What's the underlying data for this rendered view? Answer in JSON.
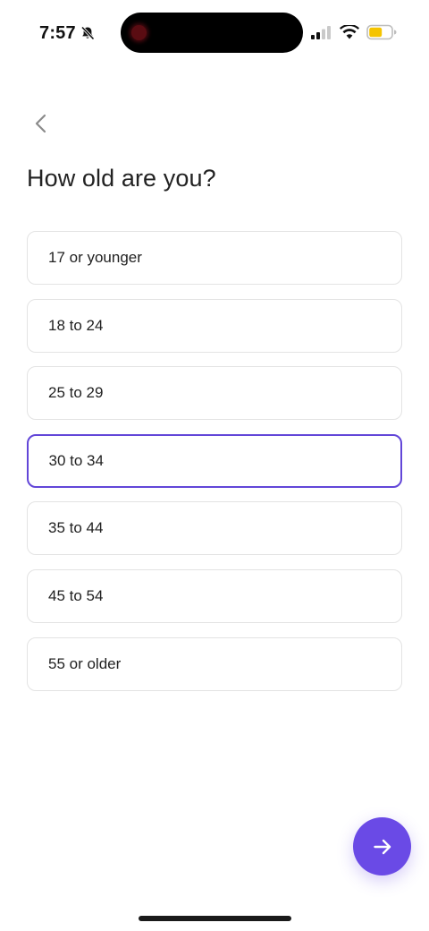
{
  "status_bar": {
    "time": "7:57",
    "icons": [
      "bell-slash-icon",
      "cellular-signal-icon",
      "wifi-icon",
      "battery-icon"
    ],
    "battery_color": "#f5c400"
  },
  "navigation": {
    "back_icon": "chevron-left-icon"
  },
  "page": {
    "title": "How old are you?"
  },
  "options": [
    {
      "label": "17 or younger",
      "selected": false
    },
    {
      "label": "18 to 24",
      "selected": false
    },
    {
      "label": "25 to 29",
      "selected": false
    },
    {
      "label": "30 to 34",
      "selected": true
    },
    {
      "label": "35 to 44",
      "selected": false
    },
    {
      "label": "45 to 54",
      "selected": false
    },
    {
      "label": "55 or older",
      "selected": false
    }
  ],
  "next_button": {
    "icon": "arrow-right-icon",
    "color": "#6a4ae6"
  },
  "colors": {
    "accent": "#6246d8",
    "option_border": "#e3e3e3",
    "text": "#222222"
  }
}
